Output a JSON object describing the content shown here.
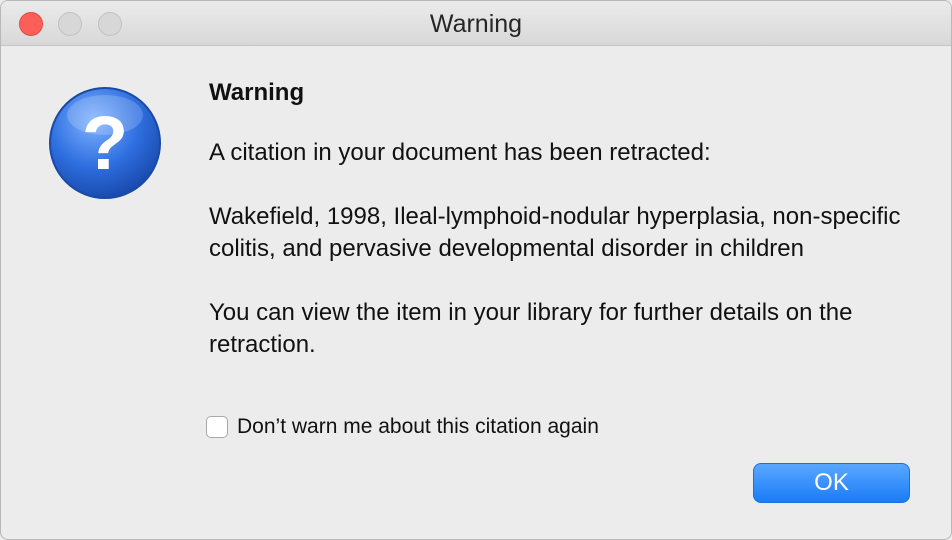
{
  "window": {
    "title": "Warning"
  },
  "dialog": {
    "icon": "question-icon",
    "heading": "Warning",
    "message": "A citation in your document has been retracted:",
    "citation": "Wakefield, 1998, Ileal-lymphoid-nodular hyperplasia, non-specific colitis, and pervasive developmental disorder in children",
    "details": "You can view the item in your library for further details on the retraction.",
    "checkbox_label": "Don’t warn me about this citation again",
    "checkbox_checked": false,
    "ok_label": "OK"
  },
  "colors": {
    "close_button": "#fc5f57",
    "accent": "#1a7cf7",
    "icon_blue": "#2f6fe0"
  }
}
